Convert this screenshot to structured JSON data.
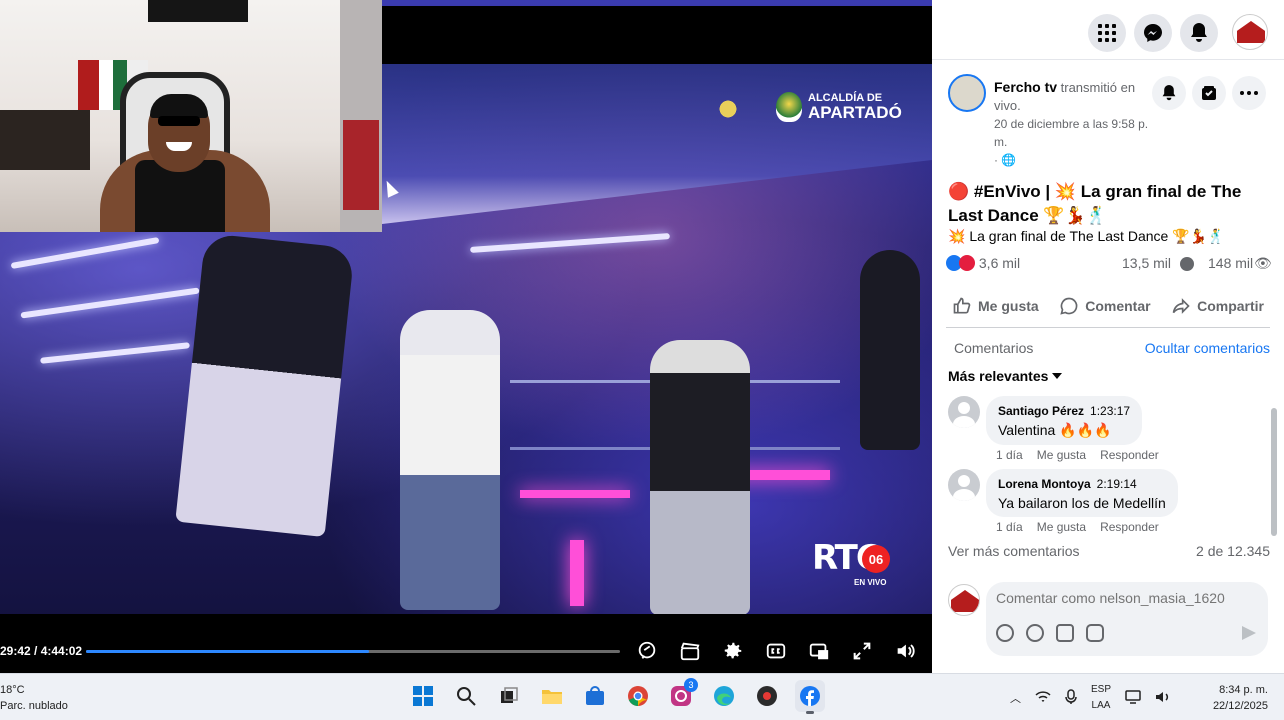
{
  "player": {
    "time": "29:42 / 4:44:02",
    "progress_fraction": 0.53,
    "overlay": {
      "alcaldia_line1": "ALCALDÍA DE",
      "alcaldia_line2": "APARTADÓ",
      "rtc": "RTC",
      "rtc_number": "06",
      "en_vivo": "EN VIVO"
    },
    "controls": [
      "live-chat-icon",
      "clapperboard-icon",
      "gear-icon",
      "captions-icon",
      "picture-in-picture-icon",
      "fullscreen-icon",
      "volume-icon"
    ]
  },
  "post": {
    "author": "Fercho tv",
    "action": " transmitió en vivo.",
    "date": "20 de diciembre a las 9:58 p. m.",
    "privacy": "· 🌐",
    "title": "🔴 #EnVivo | 💥 La gran final de The Last Dance 🏆💃🕺",
    "subtitle": "💥 La gran final de The Last Dance 🏆💃🕺",
    "reactions_count": "3,6 mil",
    "comments_count": "13,5 mil",
    "views_count": "148 mil",
    "actions": {
      "like": "Me gusta",
      "comment": "Comentar",
      "share": "Compartir"
    }
  },
  "comments_section": {
    "title": "Comentarios",
    "hide_label": "Ocultar comentarios",
    "sort_label": "Más relevantes",
    "items": [
      {
        "name": "Santiago Pérez",
        "time": "1:23:17",
        "text": "Valentina 🔥🔥🔥",
        "age": "1 día",
        "like": "Me gusta",
        "reply": "Responder"
      },
      {
        "name": "Lorena Montoya",
        "time": "2:19:14",
        "text": "Ya bailaron los de Medellín",
        "age": "1 día",
        "like": "Me gusta",
        "reply": "Responder"
      }
    ],
    "more_label": "Ver más comentarios",
    "count_label": "2 de 12.345",
    "compose_placeholder": "Comentar como nelson_masia_1620"
  },
  "taskbar": {
    "temperature": "18°C",
    "weather": "Parc. nublado",
    "lang_line1": "ESP",
    "lang_line2": "LAA",
    "time": "8:34 p. m.",
    "date": "22/12/2025",
    "badge": "3"
  },
  "colors": {
    "facebook_blue": "#1877f2",
    "progress_blue": "#2d88ff",
    "like_red": "#e41e3f"
  }
}
